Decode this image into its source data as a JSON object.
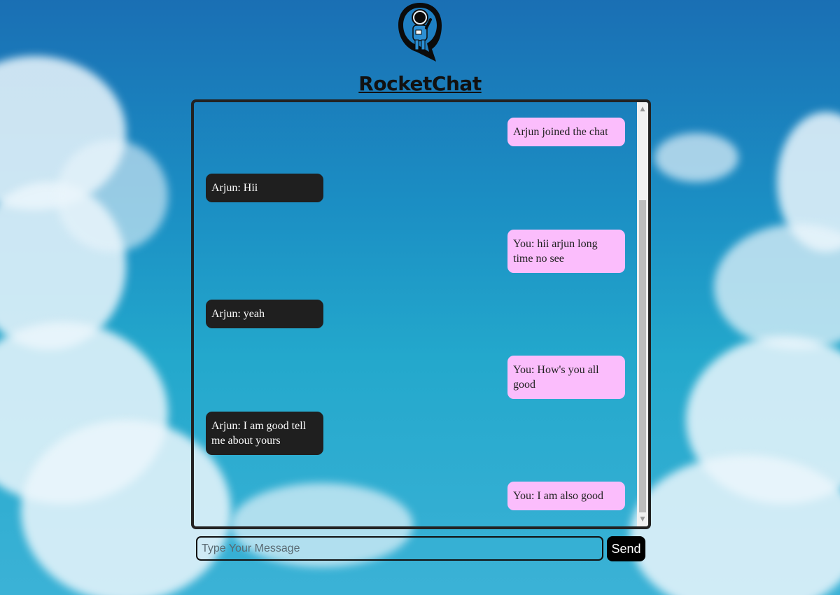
{
  "app": {
    "title": "RocketChat"
  },
  "messages": [
    {
      "direction": "out",
      "text": "Arjun joined the chat"
    },
    {
      "direction": "in",
      "text": "Arjun: Hii"
    },
    {
      "direction": "out",
      "text": "You: hii arjun long time no see"
    },
    {
      "direction": "in",
      "text": "Arjun: yeah"
    },
    {
      "direction": "out",
      "text": "You: How's you all good"
    },
    {
      "direction": "in",
      "text": "Arjun: I am good tell me about yours"
    },
    {
      "direction": "out",
      "text": "You: I am also good"
    }
  ],
  "composer": {
    "placeholder": "Type Your Message",
    "value": "",
    "send_label": "Send"
  },
  "icons": {
    "logo": "astronaut-chat-logo-icon",
    "scroll_up": "scroll-up-arrow-icon",
    "scroll_down": "scroll-down-arrow-icon"
  },
  "colors": {
    "incoming_bubble": "#1f1f1f",
    "outgoing_bubble": "#fbbdfc",
    "send_button": "#000000",
    "border": "#222222"
  }
}
